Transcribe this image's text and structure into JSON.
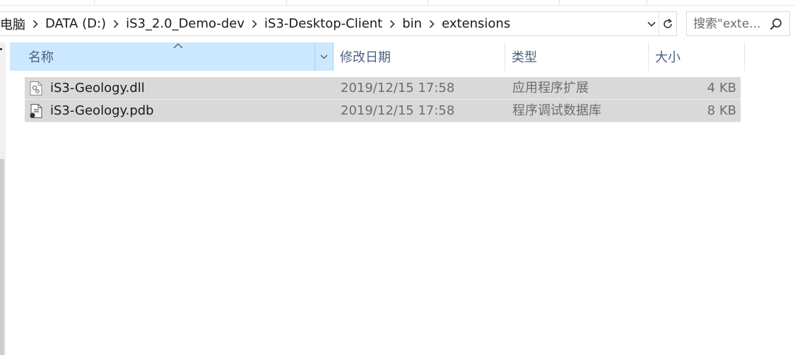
{
  "breadcrumb": {
    "items": [
      "电脑",
      "DATA (D:)",
      "iS3_2.0_Demo-dev",
      "iS3-Desktop-Client",
      "bin",
      "extensions"
    ]
  },
  "search": {
    "placeholder": "搜索\"exte..."
  },
  "columns": {
    "name": "名称",
    "date": "修改日期",
    "type": "类型",
    "size": "大小"
  },
  "files": [
    {
      "name": "iS3-Geology.dll",
      "date": "2019/12/15 17:58",
      "type": "应用程序扩展",
      "size": "4 KB",
      "icon": "dll-file-icon"
    },
    {
      "name": "iS3-Geology.pdb",
      "date": "2019/12/15 17:58",
      "type": "程序调试数据库",
      "size": "8 KB",
      "icon": "pdb-file-icon"
    }
  ],
  "colors": {
    "header_selected": "#cce8ff",
    "row_selected": "#d9d9d9",
    "header_text": "#4d6082"
  }
}
